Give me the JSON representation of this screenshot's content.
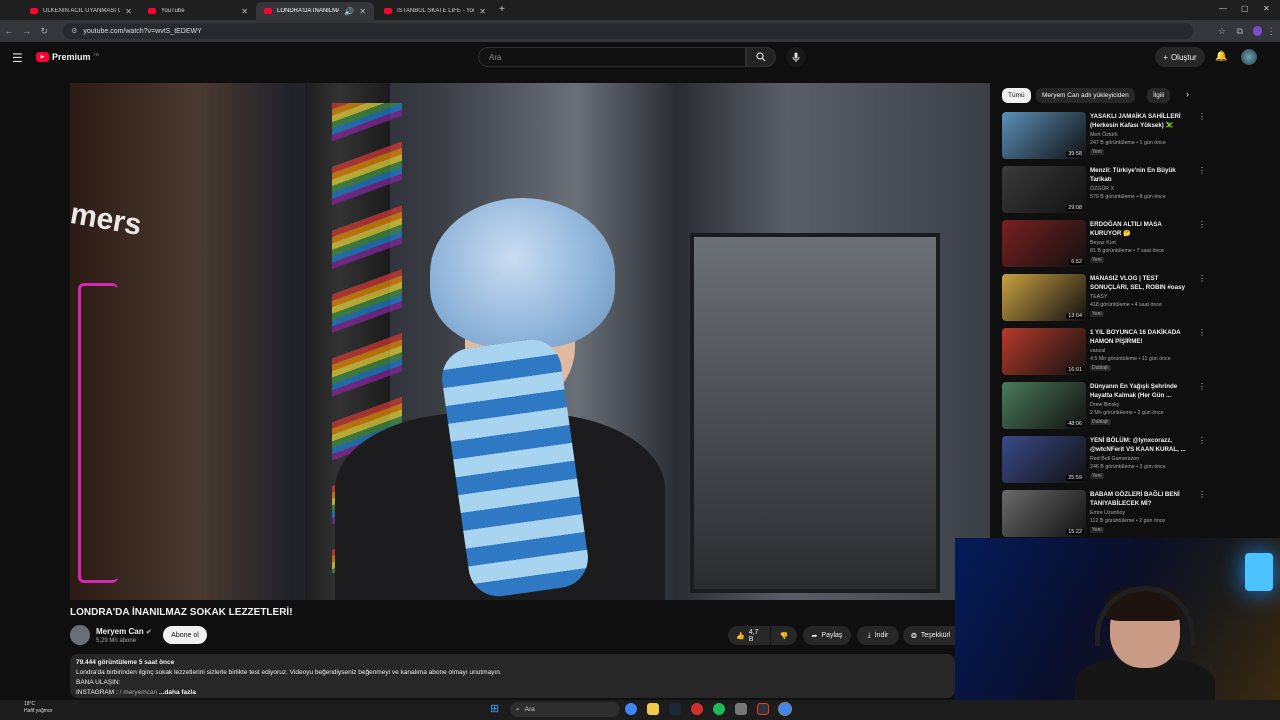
{
  "browser": {
    "tabs": [
      {
        "label": "ÜLKENİN ACİL UYANMASI GERE",
        "active": false
      },
      {
        "label": "YouTube",
        "active": false
      },
      {
        "label": "LONDRA'DA İNANILMAZ S",
        "active": true
      },
      {
        "label": "İSTANBUL SKATE LIFE - YouTube",
        "active": false
      }
    ],
    "url": "youtube.com/watch?v=wvtS_tEDEWY"
  },
  "header": {
    "logo": "Premium",
    "logo_sup": "TR",
    "search_placeholder": "Ara",
    "create_label": "Oluştur"
  },
  "video": {
    "sign_text": "mers",
    "title": "LONDRA'DA İNANILMAZ SOKAK LEZZETLERİ!",
    "channel": "Meryem Can",
    "subscribers": "5,29 Mn abone",
    "subscribe_label": "Abone ol",
    "likes": "4,7 B",
    "share_label": "Paylaş",
    "download_label": "İndir",
    "thanks_label": "Teşekkürl",
    "desc_meta": "79.444 görüntüleme  5 saat önce",
    "desc_line1": "Londra'da birbirinden ilginç sokak lezzetlerini sizlerle birlikte test ediyoruz. Videoyu beğendiyseniz beğenmeyi ve kanalıma abone olmayı unutmayın.",
    "desc_line2": "BANA ULAŞIN:",
    "desc_line3": "INSTAGRAM : ",
    "desc_handle": "/ meryemcan",
    "desc_more": "...daha fazla"
  },
  "chips": [
    "Tümü",
    "Meryem Can adlı yükleyiciden",
    "İlgili"
  ],
  "recommendations": [
    {
      "title": "YASAKLI JAMAİKA SAHİLLERİ (Herkesin Kafası Yüksek) 🇯🇲",
      "channel": "Mert Öztürk",
      "meta": "247 B görüntüleme • 1 gün önce",
      "badge": "Yeni",
      "duration": "39:58",
      "color": "#5a8fb8"
    },
    {
      "title": "Menzil: Türkiye'nin En Büyük Tarikatı",
      "channel": "ÖZGÜR X",
      "meta": "570 B görüntüleme • 8 gün önce",
      "badge": "",
      "duration": "29:08",
      "color": "#3a3a3a"
    },
    {
      "title": "ERDOĞAN ALTILI MASA KURUYOR 🤔",
      "channel": "Beyaz Kurt",
      "meta": "81 B görüntüleme • 7 saat önce",
      "badge": "Yeni",
      "duration": "6:52",
      "color": "#7a2020"
    },
    {
      "title": "MANASIZ VLOG | TEST SONUÇLARI, SEL, ROBIN #oasy",
      "channel": "TEASY",
      "meta": "418 görüntüleme • 4 saat önce",
      "badge": "Yeni",
      "duration": "13:04",
      "color": "#c9a040"
    },
    {
      "title": "1 YIL BOYUNCA 16 DAKİKADA HAMON PİŞİRME!",
      "channel": "vanzal",
      "meta": "4,5 Mn görüntüleme • 11 gün önce",
      "badge": "Dublajlı",
      "duration": "16:01",
      "color": "#b83a2a"
    },
    {
      "title": "Dünyanın En Yağışlı Şehrinde Hayatta Kalmak (Her Gün ...",
      "channel": "Drew Binsky",
      "meta": "2 Mn görüntüleme • 2 gün önce",
      "badge": "Dublajlı",
      "duration": "48:06",
      "color": "#4a7a5a"
    },
    {
      "title": "YENİ BÖLÜM: @lynxcorazz, @wtcNFerit VS KAAN KURAL, ...",
      "channel": "Red Bull Gamerazon",
      "meta": "246 B görüntüleme • 3 gün önce",
      "badge": "Yeni",
      "duration": "25:59",
      "color": "#3a4a8a"
    },
    {
      "title": "BABAM GÖZLERİ BAĞLI BENİ TANIYABİLECEK Mİ?",
      "channel": "Emre Uzunboy",
      "meta": "112 B görüntüleme • 2 gün önce",
      "badge": "Yeni",
      "duration": "15:22",
      "color": "#6a6a6a"
    }
  ],
  "taskbar": {
    "weather_temp": "18°C",
    "weather_text": "Hafif yağmur",
    "search_placeholder": "Ara"
  }
}
